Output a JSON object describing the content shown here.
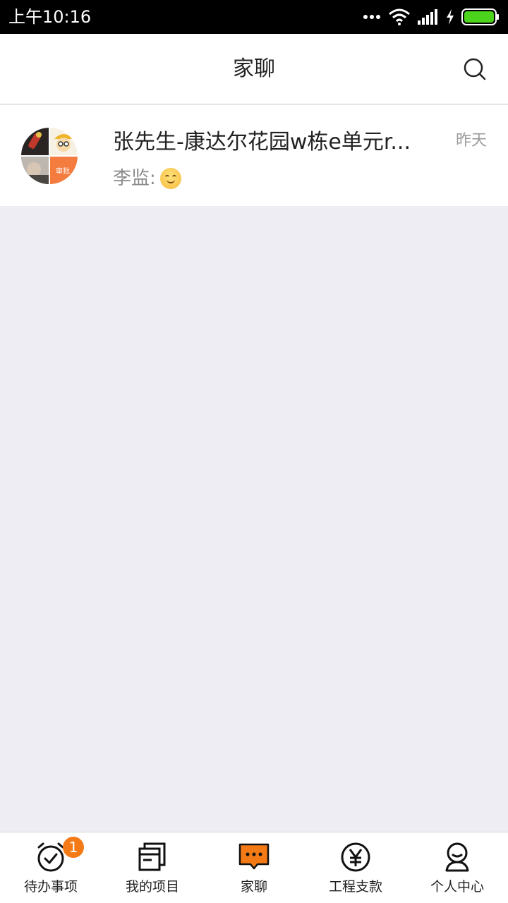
{
  "status_bar": {
    "time": "上午10:16",
    "icons": [
      "more-dots-icon",
      "wifi-icon",
      "signal-icon",
      "charging-icon",
      "battery-icon"
    ]
  },
  "header": {
    "title": "家聊",
    "search_icon": "search-icon"
  },
  "chats": [
    {
      "name": "张先生-康达尔花园w栋e单元r...",
      "time": "昨天",
      "preview": "李监:",
      "preview_emoji": "smile"
    }
  ],
  "tabs": [
    {
      "label": "待办事项",
      "icon": "alarm-check-icon",
      "badge": "1"
    },
    {
      "label": "我的项目",
      "icon": "project-stack-icon"
    },
    {
      "label": "家聊",
      "icon": "chat-bubble-icon",
      "active": true
    },
    {
      "label": "工程支款",
      "icon": "yen-icon"
    },
    {
      "label": "个人中心",
      "icon": "person-icon"
    }
  ],
  "colors": {
    "accent": "#f47a16",
    "background": "#eeedf3",
    "status_bar": "#000000",
    "battery": "#4cd31b"
  }
}
